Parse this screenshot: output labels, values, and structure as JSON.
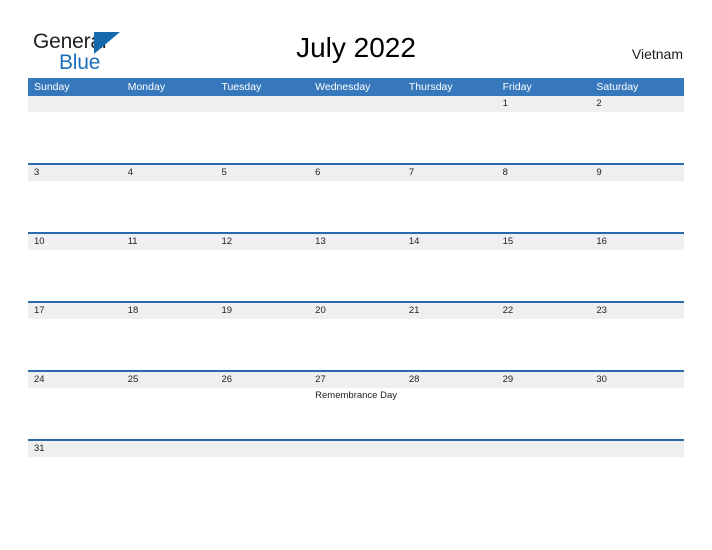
{
  "brand": {
    "word_one": "General",
    "word_two": "Blue",
    "triangle_icon": "triangle-icon",
    "accent_blue": "#1c6fb8"
  },
  "header": {
    "title": "July 2022",
    "country": "Vietnam"
  },
  "colors": {
    "header_band": "#3778bd",
    "row_divider": "#2a69ad",
    "day_band": "#efefef",
    "page_background": "#ffffff",
    "text": "#222222"
  },
  "calendar": {
    "month": "July",
    "year": "2022",
    "weekday_headers": [
      "Sunday",
      "Monday",
      "Tuesday",
      "Wednesday",
      "Thursday",
      "Friday",
      "Saturday"
    ],
    "weeks": [
      {
        "days": [
          {
            "num": "",
            "event": ""
          },
          {
            "num": "",
            "event": ""
          },
          {
            "num": "",
            "event": ""
          },
          {
            "num": "",
            "event": ""
          },
          {
            "num": "",
            "event": ""
          },
          {
            "num": "1",
            "event": ""
          },
          {
            "num": "2",
            "event": ""
          }
        ]
      },
      {
        "days": [
          {
            "num": "3",
            "event": ""
          },
          {
            "num": "4",
            "event": ""
          },
          {
            "num": "5",
            "event": ""
          },
          {
            "num": "6",
            "event": ""
          },
          {
            "num": "7",
            "event": ""
          },
          {
            "num": "8",
            "event": ""
          },
          {
            "num": "9",
            "event": ""
          }
        ]
      },
      {
        "days": [
          {
            "num": "10",
            "event": ""
          },
          {
            "num": "11",
            "event": ""
          },
          {
            "num": "12",
            "event": ""
          },
          {
            "num": "13",
            "event": ""
          },
          {
            "num": "14",
            "event": ""
          },
          {
            "num": "15",
            "event": ""
          },
          {
            "num": "16",
            "event": ""
          }
        ]
      },
      {
        "days": [
          {
            "num": "17",
            "event": ""
          },
          {
            "num": "18",
            "event": ""
          },
          {
            "num": "19",
            "event": ""
          },
          {
            "num": "20",
            "event": ""
          },
          {
            "num": "21",
            "event": ""
          },
          {
            "num": "22",
            "event": ""
          },
          {
            "num": "23",
            "event": ""
          }
        ]
      },
      {
        "days": [
          {
            "num": "24",
            "event": ""
          },
          {
            "num": "25",
            "event": ""
          },
          {
            "num": "26",
            "event": ""
          },
          {
            "num": "27",
            "event": "Remembrance Day"
          },
          {
            "num": "28",
            "event": ""
          },
          {
            "num": "29",
            "event": ""
          },
          {
            "num": "30",
            "event": ""
          }
        ]
      },
      {
        "days": [
          {
            "num": "31",
            "event": ""
          },
          {
            "num": "",
            "event": ""
          },
          {
            "num": "",
            "event": ""
          },
          {
            "num": "",
            "event": ""
          },
          {
            "num": "",
            "event": ""
          },
          {
            "num": "",
            "event": ""
          },
          {
            "num": "",
            "event": ""
          }
        ]
      }
    ]
  }
}
